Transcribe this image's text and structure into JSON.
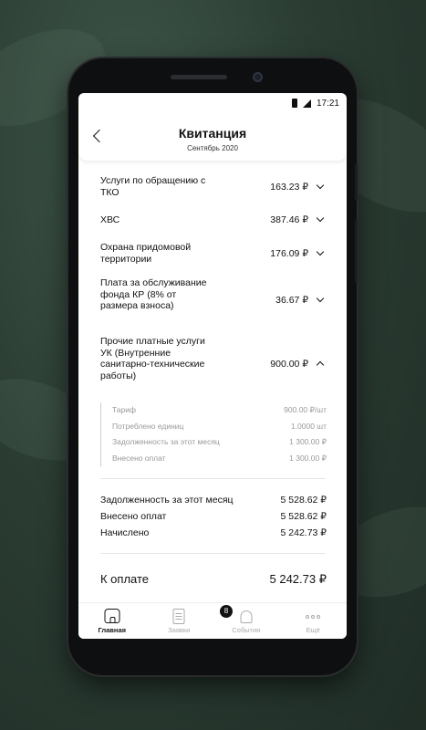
{
  "status_bar": {
    "time": "17:21"
  },
  "header": {
    "title": "Квитанция",
    "subtitle": "Сентябрь 2020"
  },
  "items": [
    {
      "label": "Услуги по обращению с ТКО",
      "amount": "163.23 ₽",
      "expanded": false
    },
    {
      "label": "ХВС",
      "amount": "387.46 ₽",
      "expanded": false
    },
    {
      "label": "Охрана придомовой территории",
      "amount": "176.09 ₽",
      "expanded": false
    },
    {
      "label": "Плата за обслуживание фонда КР (8% от размера взноса)",
      "amount": "36.67 ₽",
      "expanded": false
    },
    {
      "label": "Прочие платные услуги УК (Внутренние санитарно-технические работы)",
      "amount": "900.00 ₽",
      "expanded": true
    }
  ],
  "details": [
    {
      "label": "Тариф",
      "value": "900.00 ₽/шт"
    },
    {
      "label": "Потреблено единиц",
      "value": "1.0000 шт"
    },
    {
      "label": "Задолженность за этот месяц",
      "value": "1 300.00 ₽"
    },
    {
      "label": "Внесено оплат",
      "value": "1 300.00 ₽"
    }
  ],
  "summary": [
    {
      "label": "Задолженность за этот месяц",
      "value": "5 528.62 ₽"
    },
    {
      "label": "Внесено оплат",
      "value": "5 528.62 ₽"
    },
    {
      "label": "Начислено",
      "value": "5 242.73 ₽"
    }
  ],
  "total": {
    "label": "К оплате",
    "value": "5 242.73 ₽"
  },
  "tabs": [
    {
      "label": "Главная",
      "icon": "home-icon",
      "active": true
    },
    {
      "label": "Заявки",
      "icon": "requests-icon",
      "active": false
    },
    {
      "label": "События",
      "icon": "bell-icon",
      "active": false,
      "badge": "8"
    },
    {
      "label": "Ещё",
      "icon": "more-icon",
      "active": false
    }
  ]
}
